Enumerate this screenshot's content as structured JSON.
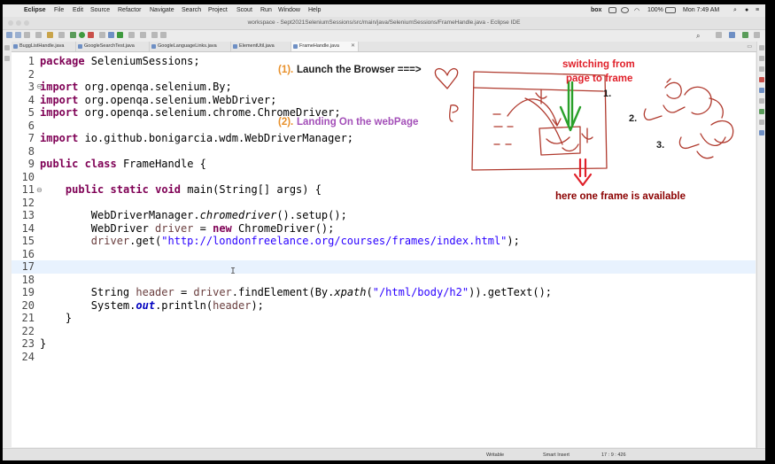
{
  "menubar": {
    "app_name": "Eclipse",
    "items": [
      "File",
      "Edit",
      "Source",
      "Refactor",
      "Navigate",
      "Search",
      "Project",
      "Scout",
      "Run",
      "Window",
      "Help"
    ],
    "tray": {
      "box": "box",
      "battery": "100%",
      "clock": "Mon 7:49 AM"
    }
  },
  "window": {
    "title": "workspace - Sept2021SeleniumSessions/src/main/java/SeleniumSessions/FrameHandle.java - Eclipse IDE"
  },
  "tabs": [
    {
      "label": "BuggListHandle.java",
      "active": false
    },
    {
      "label": "GoogleSearchTest.java",
      "active": false
    },
    {
      "label": "GoogleLanguageLinks.java",
      "active": false
    },
    {
      "label": "ElementUtil.java",
      "active": false
    },
    {
      "label": "FrameHandle.java",
      "active": true
    }
  ],
  "editor": {
    "current_line": 17,
    "lines": [
      {
        "n": "1",
        "segs": [
          {
            "t": "package",
            "c": "kw"
          },
          {
            "t": " SeleniumSessions;",
            "c": ""
          }
        ]
      },
      {
        "n": "2",
        "segs": []
      },
      {
        "n": "3",
        "segs": [
          {
            "t": "import",
            "c": "kw"
          },
          {
            "t": " org.openqa.selenium.By;",
            "c": ""
          }
        ]
      },
      {
        "n": "4",
        "segs": [
          {
            "t": "import",
            "c": "kw"
          },
          {
            "t": " org.openqa.selenium.WebDriver;",
            "c": ""
          }
        ]
      },
      {
        "n": "5",
        "segs": [
          {
            "t": "import",
            "c": "kw"
          },
          {
            "t": " org.openqa.selenium.chrome.ChromeDriver;",
            "c": ""
          }
        ]
      },
      {
        "n": "6",
        "segs": []
      },
      {
        "n": "7",
        "segs": [
          {
            "t": "import",
            "c": "kw"
          },
          {
            "t": " io.github.bonigarcia.wdm.WebDriverManager;",
            "c": ""
          }
        ]
      },
      {
        "n": "8",
        "segs": []
      },
      {
        "n": "9",
        "segs": [
          {
            "t": "public",
            "c": "kw"
          },
          {
            "t": " ",
            "c": ""
          },
          {
            "t": "class",
            "c": "kw"
          },
          {
            "t": " FrameHandle {",
            "c": ""
          }
        ]
      },
      {
        "n": "10",
        "segs": []
      },
      {
        "n": "11",
        "segs": [
          {
            "t": "    ",
            "c": ""
          },
          {
            "t": "public",
            "c": "kw"
          },
          {
            "t": " ",
            "c": ""
          },
          {
            "t": "static",
            "c": "kw"
          },
          {
            "t": " ",
            "c": ""
          },
          {
            "t": "void",
            "c": "kw"
          },
          {
            "t": " main(String[] args) {",
            "c": ""
          }
        ]
      },
      {
        "n": "12",
        "segs": []
      },
      {
        "n": "13",
        "segs": [
          {
            "t": "        WebDriverManager.",
            "c": ""
          },
          {
            "t": "chromedriver",
            "c": "it"
          },
          {
            "t": "().setup();",
            "c": ""
          }
        ]
      },
      {
        "n": "14",
        "segs": [
          {
            "t": "        WebDriver ",
            "c": ""
          },
          {
            "t": "driver",
            "c": "var"
          },
          {
            "t": " = ",
            "c": ""
          },
          {
            "t": "new",
            "c": "kw"
          },
          {
            "t": " ChromeDriver();",
            "c": ""
          }
        ]
      },
      {
        "n": "15",
        "segs": [
          {
            "t": "        ",
            "c": ""
          },
          {
            "t": "driver",
            "c": "var"
          },
          {
            "t": ".get(",
            "c": ""
          },
          {
            "t": "\"http://londonfreelance.org/courses/frames/index.html\"",
            "c": "str"
          },
          {
            "t": ");",
            "c": ""
          }
        ]
      },
      {
        "n": "16",
        "segs": []
      },
      {
        "n": "17",
        "segs": []
      },
      {
        "n": "18",
        "segs": []
      },
      {
        "n": "19",
        "segs": [
          {
            "t": "        String ",
            "c": ""
          },
          {
            "t": "header",
            "c": "var"
          },
          {
            "t": " = ",
            "c": ""
          },
          {
            "t": "driver",
            "c": "var"
          },
          {
            "t": ".findElement(By.",
            "c": ""
          },
          {
            "t": "xpath",
            "c": "it"
          },
          {
            "t": "(",
            "c": ""
          },
          {
            "t": "\"/html/body/h2\"",
            "c": "str"
          },
          {
            "t": ")).getText();",
            "c": ""
          }
        ]
      },
      {
        "n": "20",
        "segs": [
          {
            "t": "        System.",
            "c": ""
          },
          {
            "t": "out",
            "c": "fld"
          },
          {
            "t": ".println(",
            "c": ""
          },
          {
            "t": "header",
            "c": "var"
          },
          {
            "t": ");",
            "c": ""
          }
        ]
      },
      {
        "n": "21",
        "segs": [
          {
            "t": "    }",
            "c": ""
          }
        ]
      },
      {
        "n": "22",
        "segs": []
      },
      {
        "n": "23",
        "segs": [
          {
            "t": "}",
            "c": ""
          }
        ]
      },
      {
        "n": "24",
        "segs": []
      }
    ]
  },
  "annotations": {
    "launch_num": "(1).",
    "launch_text": "Launch the Browser ===>",
    "landing_num": "(2).",
    "landing_text": "Landing On the webPage",
    "switching_line1": "switching from",
    "switching_line2": "page to frame",
    "frame_available": "here one frame is available",
    "step1": "1.",
    "step2": "2.",
    "step3": "3.",
    "colors": {
      "orange": "#e8902a",
      "purple": "#a34fb8",
      "red": "#e0202a",
      "dark_red": "#8b0000",
      "green": "#2aa02a",
      "sketch": "#b03a2e"
    }
  },
  "statusbar": {
    "mode": "Writable",
    "insert": "Smart Insert",
    "position": "17 : 9 : 426"
  }
}
